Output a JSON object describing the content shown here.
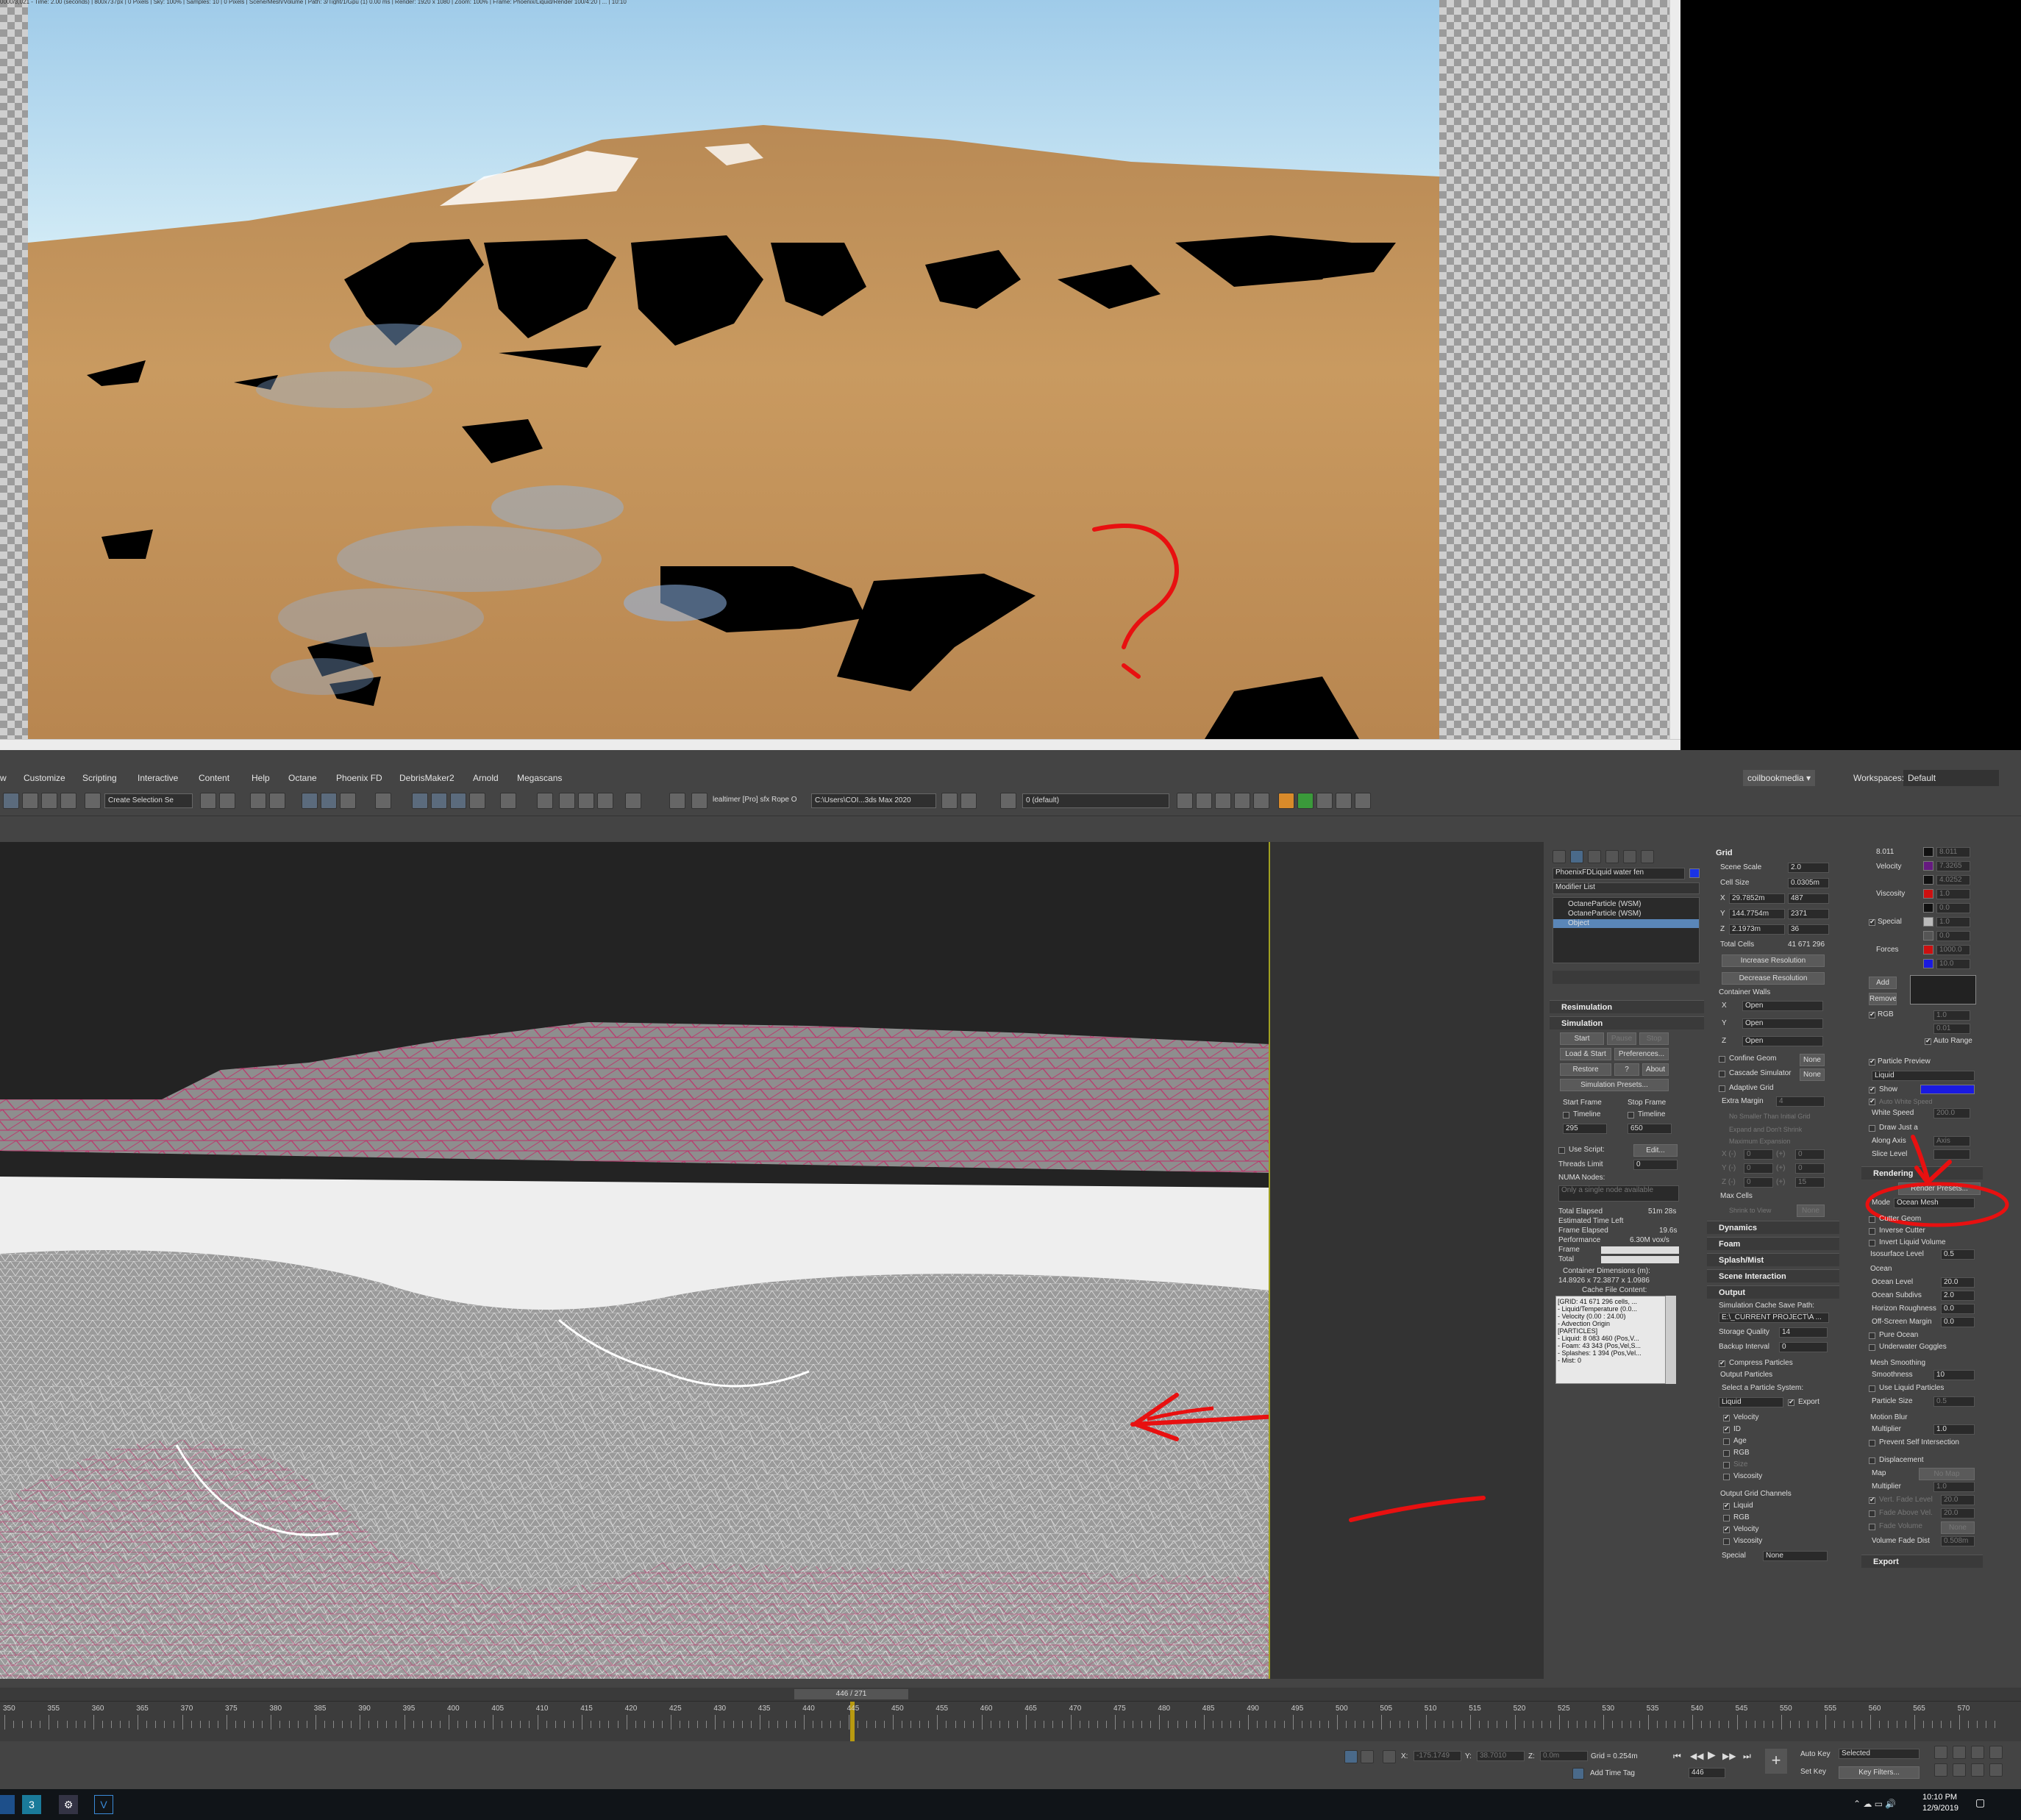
{
  "render_window": {
    "status_text": "0000/3,021 - Time: 2.00 (seconds) | 800x737px | 0 Pixels | Sky: 100% | Samples: 10 | 0 Pixels | Scene/Mesh/Volume | Path: 3/Tight/1/Gpu (1) 0.00 ms | Render: 1920 x 1080 | Zoom: 100% | Frame: Phoenix/Liquid/Render 100/4:20 | ... | 10:10"
  },
  "menu": {
    "items": [
      "w",
      "Customize",
      "Scripting",
      "Interactive",
      "Content",
      "Help",
      "Octane",
      "Phoenix FD",
      "DebrisMaker2",
      "Arnold",
      "Megascans"
    ],
    "user": "coilbookmedia ▾",
    "workspaces_label": "Workspaces:",
    "workspaces_value": "Default"
  },
  "toolbar": {
    "selection_set": "Create Selection Se",
    "realtime": "lealtimer [Pro] sfx Rope O",
    "path": "C:\\Users\\COI...3ds Max 2020",
    "layer": "0 (default)"
  },
  "cmd": {
    "object_name": "PhoenixFDLiquid water fen",
    "modifier_list": "Modifier List",
    "stack": [
      "OctaneParticle (WSM)",
      "OctaneParticle (WSM)",
      "Object"
    ],
    "rollouts_left": {
      "resimulation": "Resimulation",
      "simulation": "Simulation"
    },
    "sim_buttons": [
      "Start",
      "Pause",
      "Stop",
      "Load & Start",
      "Preferences...",
      "Restore",
      "?",
      "About",
      "Simulation Presets..."
    ],
    "start_frame_label": "Start Frame",
    "stop_frame_label": "Stop Frame",
    "timeline1": "Timeline",
    "timeline2": "Timeline",
    "start_frame": "295",
    "stop_frame": "650",
    "use_script": "Use Script:",
    "edit_btn": "Edit...",
    "threads_limit_label": "Threads Limit",
    "threads_limit": "0",
    "numa_label": "NUMA Nodes:",
    "numa_placeholder": "Only a single node available",
    "stats": [
      [
        "Total Elapsed",
        "51m 28s"
      ],
      [
        "Estimated Time Left",
        ""
      ],
      [
        "Frame Elapsed",
        "19.6s"
      ],
      [
        "Performance",
        "6.30M vox/s"
      ],
      [
        "Frame",
        ""
      ],
      [
        "Total",
        ""
      ]
    ],
    "container_dims_label": "Container Dimensions (m):",
    "container_dims": "14.8926 x 72.3877 x 1.0986",
    "cache_label": "Cache File Content:",
    "cache_lines": [
      "[GRID: 41 671 296 cells, ...",
      "- Liquid/Temperature (0.0...",
      "- Velocity (0.00 : 24.00)",
      "- Advection Origin",
      "[PARTICLES]",
      "- Liquid: 8 083 460 (Pos,V...",
      "- Foam: 43 343 (Pos,Vel,S...",
      "- Splashes: 1 394 (Pos,Vel...",
      "- Mist: 0"
    ],
    "grid_hdr": "Grid",
    "scene_scale_label": "Scene Scale",
    "scene_scale": "2.0",
    "cell_size_label": "Cell Size",
    "cell_size": "0.0305m",
    "xyz": [
      [
        "X",
        "29.7852m",
        "487"
      ],
      [
        "Y",
        "144.7754m",
        "2371"
      ],
      [
        "Z",
        "2.1973m",
        "36"
      ]
    ],
    "total_cells_label": "Total Cells",
    "total_cells": "41 671 296",
    "increase_res": "Increase Resolution",
    "decrease_res": "Decrease Resolution",
    "container_walls": "Container Walls",
    "walls": [
      [
        "X",
        "Open"
      ],
      [
        "Y",
        "Open"
      ],
      [
        "Z",
        "Open"
      ]
    ],
    "confine_geom": "Confine Geom",
    "cascade_sim": "Cascade Simulator",
    "none": "None",
    "adaptive_grid": "Adaptive Grid",
    "extra_margin": "Extra Margin",
    "extra_margin_val": "4",
    "no_smaller": "No Smaller Than Initial Grid",
    "expand_dont_shrink": "Expand and Don't Shrink",
    "max_expansion": "Maximum Expansion",
    "exp_rows": [
      [
        "X (-)",
        "0",
        "(+)",
        "0"
      ],
      [
        "Y (-)",
        "0",
        "(+)",
        "0"
      ],
      [
        "Z (-)",
        "0",
        "(+)",
        "15"
      ]
    ],
    "max_cells": "Max Cells",
    "shrink_to_view": "Shrink to View",
    "dynamics": "Dynamics",
    "foam": "Foam",
    "splash_mist": "Splash/Mist",
    "scene_interaction": "Scene Interaction",
    "output": "Output",
    "cache_path_label": "Simulation Cache Save Path:",
    "cache_path": "E:\\_CURRENT PROJECT\\A ...",
    "storage_quality_label": "Storage Quality",
    "storage_quality": "14",
    "backup_interval_label": "Backup Interval",
    "backup_interval": "0",
    "compress_particles": "Compress Particles",
    "output_particles": "Output Particles",
    "select_ps": "Select a Particle System:",
    "ps_value": "Liquid",
    "export": "Export",
    "particle_channels": [
      "Velocity",
      "ID",
      "Age",
      "RGB",
      "Size",
      "Viscosity"
    ],
    "output_grid_channels": "Output Grid Channels",
    "grid_channels": [
      "Liquid",
      "RGB",
      "Velocity",
      "Viscosity"
    ],
    "special_label": "Special",
    "special_value": "None",
    "right_channels": [
      [
        "Velocity",
        ""
      ],
      [
        "Viscosity",
        ""
      ],
      [
        "Special",
        ""
      ],
      [
        "Forces",
        ""
      ]
    ],
    "right_vals": [
      "8.011",
      "7.3265",
      "4.0252",
      "1.0",
      "0.0",
      "1.0",
      "0.0",
      "0.001",
      "1000.0",
      "10.0"
    ],
    "add": "Add",
    "remove": "Remove",
    "rgb": "RGB",
    "auto_range": "Auto Range",
    "rv1": "1.0",
    "rv2": "0.01",
    "particle_preview": "Particle Preview",
    "liquid": "Liquid",
    "show": "Show",
    "auto_white_speed": "Auto White Speed",
    "white_speed": "White Speed",
    "white_speed_val": "200.0",
    "draw_just_a": "Draw Just a",
    "along_axis": "Along Axis",
    "axis_val": "Axis",
    "slice_level": "Slice Level",
    "rendering": "Rendering",
    "render_presets": "Render Presets...",
    "mode_label": "Mode",
    "mode_value": "Ocean Mesh",
    "cutter_geom": "Cutter Geom",
    "inverse_cutter": "Inverse Cutter",
    "invert_liquid_volume": "Invert Liquid Volume",
    "isosurface_level": "Isosurface Level",
    "iso_val": "0.5",
    "ocean": "Ocean",
    "ocean_level": "Ocean Level",
    "ocean_level_val": "20.0",
    "ocean_subdivs": "Ocean Subdivs",
    "ocean_subdivs_val": "2.0",
    "horizon_roughness": "Horizon Roughness",
    "horizon_roughness_val": "0.0",
    "offscreen_margin": "Off-Screen Margin",
    "offscreen_margin_val": "0.0",
    "pure_ocean": "Pure Ocean",
    "underwater_goggles": "Underwater Goggles",
    "mesh_smoothing": "Mesh Smoothing",
    "smoothness": "Smoothness",
    "smoothness_val": "10",
    "use_liquid_particles": "Use Liquid Particles",
    "particle_size": "Particle Size",
    "particle_size_val": "0.5",
    "motion_blur": "Motion Blur",
    "multiplier": "Multiplier",
    "multiplier_val": "1.0",
    "prevent_self": "Prevent Self Intersection",
    "displacement": "Displacement",
    "map": "Map",
    "no_map": "No Map",
    "multiplier2_val": "1.0",
    "vert_fade_level": "Vert. Fade Level",
    "vert_fade_val": "20.0",
    "fade_above_vel": "Fade Above Vel.",
    "fade_above_val": "20.0",
    "fade_volume": "Fade Volume",
    "fade_volume_val": "None",
    "volume_fade_dist": "Volume Fade Dist",
    "volume_fade_val": "0.508m",
    "export_hdr": "Export"
  },
  "timeline": {
    "frame_display": "446 / 271",
    "ticks": [
      "350",
      "355",
      "360",
      "365",
      "370",
      "375",
      "380",
      "385",
      "390",
      "395",
      "400",
      "405",
      "410",
      "415",
      "420",
      "425",
      "430",
      "435",
      "440",
      "445",
      "450",
      "455",
      "460",
      "465",
      "470",
      "475",
      "480",
      "485",
      "490",
      "495",
      "500",
      "505",
      "510",
      "515",
      "520",
      "525",
      "530",
      "535",
      "540",
      "545",
      "550",
      "555",
      "560",
      "565",
      "570"
    ]
  },
  "status": {
    "x": "-175.1749",
    "y": "38.7010",
    "z": "0.0m",
    "grid": "Grid = 0.254m",
    "add_time_tag": "Add Time Tag",
    "auto_key": "Auto Key",
    "selected": "Selected",
    "set_key": "Set Key",
    "key_filters": "Key Filters...",
    "frame": "446",
    "x_label": "X:",
    "y_label": "Y:",
    "z_label": "Z:"
  },
  "taskbar": {
    "time": "10:10 PM",
    "date": "12/9/2019"
  },
  "colors": {
    "sky_top": "#a9d4ef",
    "ground": "#c8965a",
    "annotation": "#e81010",
    "wire_pink": "#c0306a",
    "viewport_bg": "#232323",
    "panel": "#444444"
  }
}
